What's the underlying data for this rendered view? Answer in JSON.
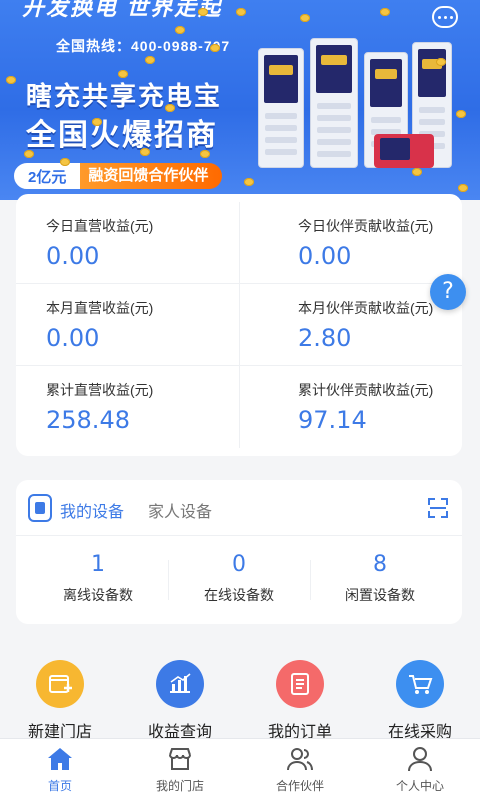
{
  "banner": {
    "top_text": "开发换电 世界走起",
    "hotline": "全国热线：400-0988-707",
    "title_line1": "瞎充共享充电宝",
    "title_line2": "全国火爆招商",
    "tag_amount": "2亿元",
    "tag_text": "融资回馈合作伙伴"
  },
  "earnings": {
    "today_direct": {
      "label": "今日直营收益(元)",
      "value": "0.00"
    },
    "today_partner": {
      "label": "今日伙伴贡献收益(元)",
      "value": "0.00"
    },
    "month_direct": {
      "label": "本月直营收益(元)",
      "value": "0.00"
    },
    "month_partner": {
      "label": "本月伙伴贡献收益(元)",
      "value": "2.80"
    },
    "total_direct": {
      "label": "累计直营收益(元)",
      "value": "258.48"
    },
    "total_partner": {
      "label": "累计伙伴贡献收益(元)",
      "value": "97.14"
    }
  },
  "help_symbol": "?",
  "devices": {
    "tab_mine": "我的设备",
    "tab_family": "家人设备",
    "stats": [
      {
        "num": "1",
        "label": "离线设备数"
      },
      {
        "num": "0",
        "label": "在线设备数"
      },
      {
        "num": "8",
        "label": "闲置设备数"
      }
    ]
  },
  "actions": [
    {
      "label": "新建门店",
      "icon": "new-store-icon",
      "color": "#f7b731"
    },
    {
      "label": "收益查询",
      "icon": "chart-icon",
      "color": "#3d7ae6"
    },
    {
      "label": "我的订单",
      "icon": "order-icon",
      "color": "#f46a6a"
    },
    {
      "label": "在线采购",
      "icon": "cart-icon",
      "color": "#3d8ff0"
    }
  ],
  "nav": [
    {
      "label": "首页",
      "icon": "home-icon",
      "active": true
    },
    {
      "label": "我的门店",
      "icon": "store-icon",
      "active": false
    },
    {
      "label": "合作伙伴",
      "icon": "partners-icon",
      "active": false
    },
    {
      "label": "个人中心",
      "icon": "profile-icon",
      "active": false
    }
  ],
  "colors": {
    "accent": "#3d7ae6",
    "banner_blue": "#2f6de6",
    "tag_orange": "#ff7a10"
  }
}
